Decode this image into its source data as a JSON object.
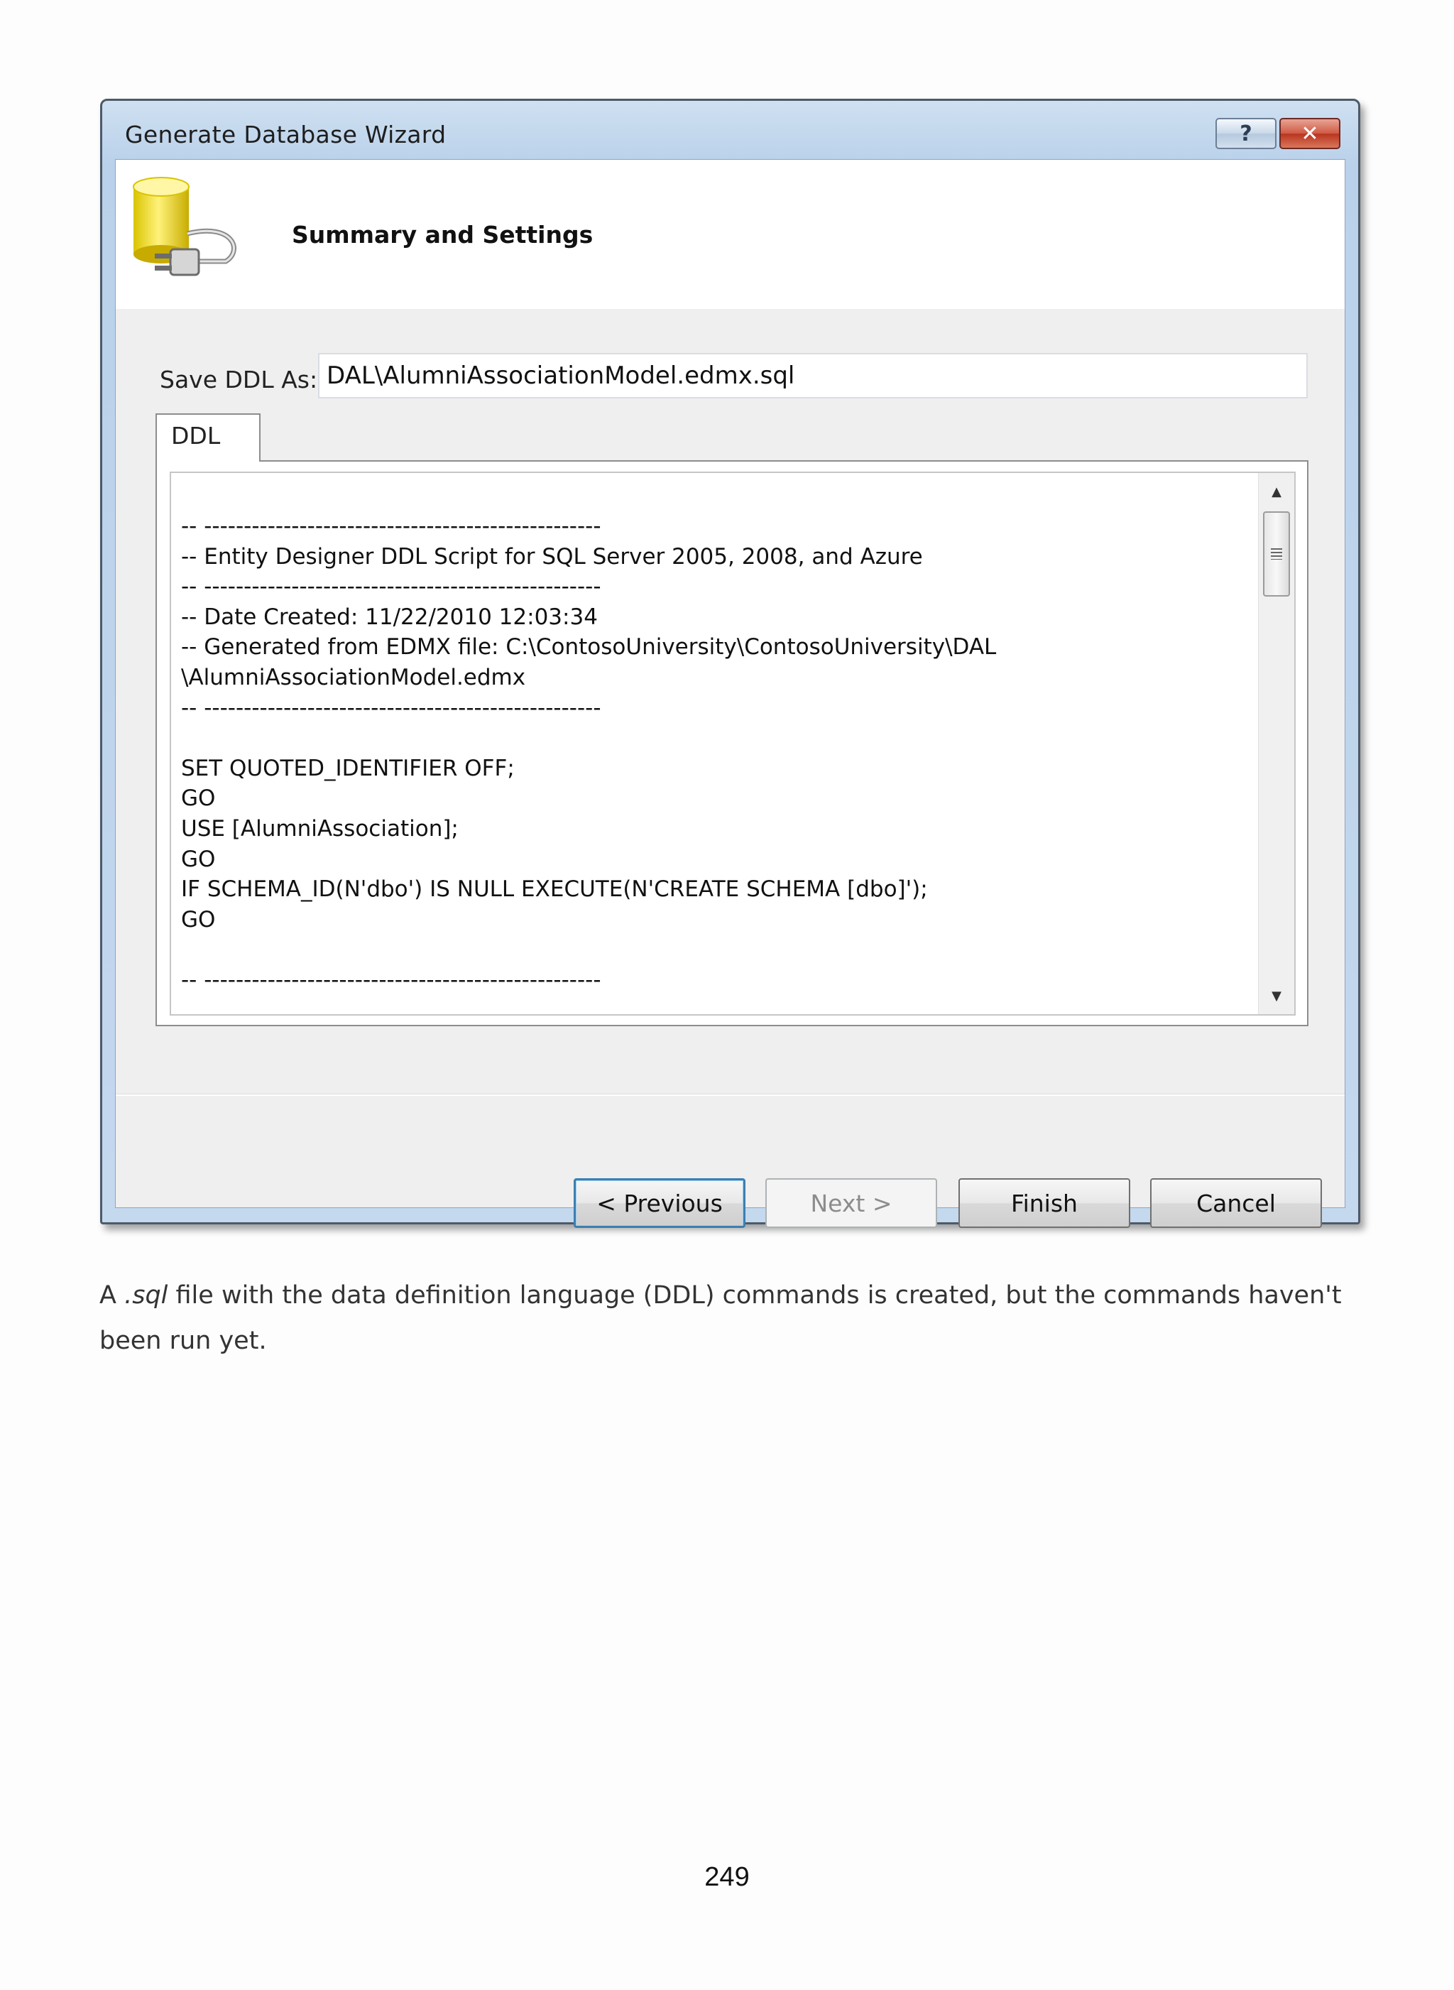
{
  "window": {
    "title": "Generate Database Wizard",
    "help_glyph": "?",
    "close_glyph": "✕"
  },
  "header": {
    "title": "Summary and Settings",
    "icon": "database-plug-icon"
  },
  "save_ddl": {
    "label": "Save DDL As:",
    "value": "DAL\\AlumniAssociationModel.edmx.sql"
  },
  "tabs": [
    {
      "label": "DDL",
      "selected": true
    }
  ],
  "ddl_text": [
    "-- --------------------------------------------------",
    "-- Entity Designer DDL Script for SQL Server 2005, 2008, and Azure",
    "-- --------------------------------------------------",
    "-- Date Created: 11/22/2010 12:03:34",
    "-- Generated from EDMX file: C:\\ContosoUniversity\\ContosoUniversity\\DAL",
    "\\AlumniAssociationModel.edmx",
    "-- --------------------------------------------------",
    "",
    "SET QUOTED_IDENTIFIER OFF;",
    "GO",
    "USE [AlumniAssociation];",
    "GO",
    "IF SCHEMA_ID(N'dbo') IS NULL EXECUTE(N'CREATE SCHEMA [dbo]');",
    "GO",
    "",
    "-- --------------------------------------------------"
  ],
  "buttons": {
    "previous": "< Previous",
    "next": "Next >",
    "finish": "Finish",
    "cancel": "Cancel"
  },
  "caption": {
    "prefix": "A ",
    "emphasis": ".sql",
    "suffix": " file with the data definition language (DDL) commands is created, but the commands haven't been run yet."
  },
  "page_number": "249",
  "colors": {
    "title_bar": "#b9d1ea",
    "close_button": "#c8432a",
    "default_button_border": "#3c7fb1"
  }
}
